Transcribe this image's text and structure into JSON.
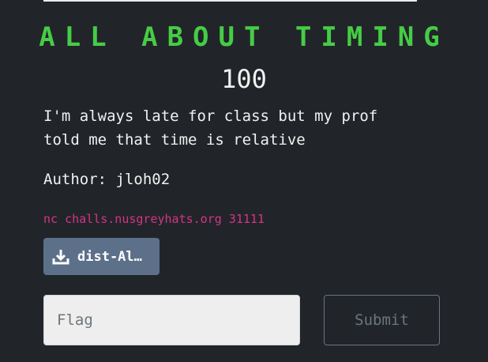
{
  "challenge": {
    "title": "ALL ABOUT TIMING",
    "points": "100",
    "description": "I'm always late for class but my prof told me that time is relative",
    "author": "Author: jloh02",
    "connection": "nc challs.nusgreyhats.org 31111"
  },
  "files": {
    "download_label": "dist-Al…",
    "icon": "download-icon"
  },
  "form": {
    "flag_placeholder": "Flag",
    "flag_value": "",
    "submit_label": "Submit"
  },
  "colors": {
    "background": "#212529",
    "title": "#46cc46",
    "connection": "#d63384",
    "file_button": "#5c7089"
  }
}
